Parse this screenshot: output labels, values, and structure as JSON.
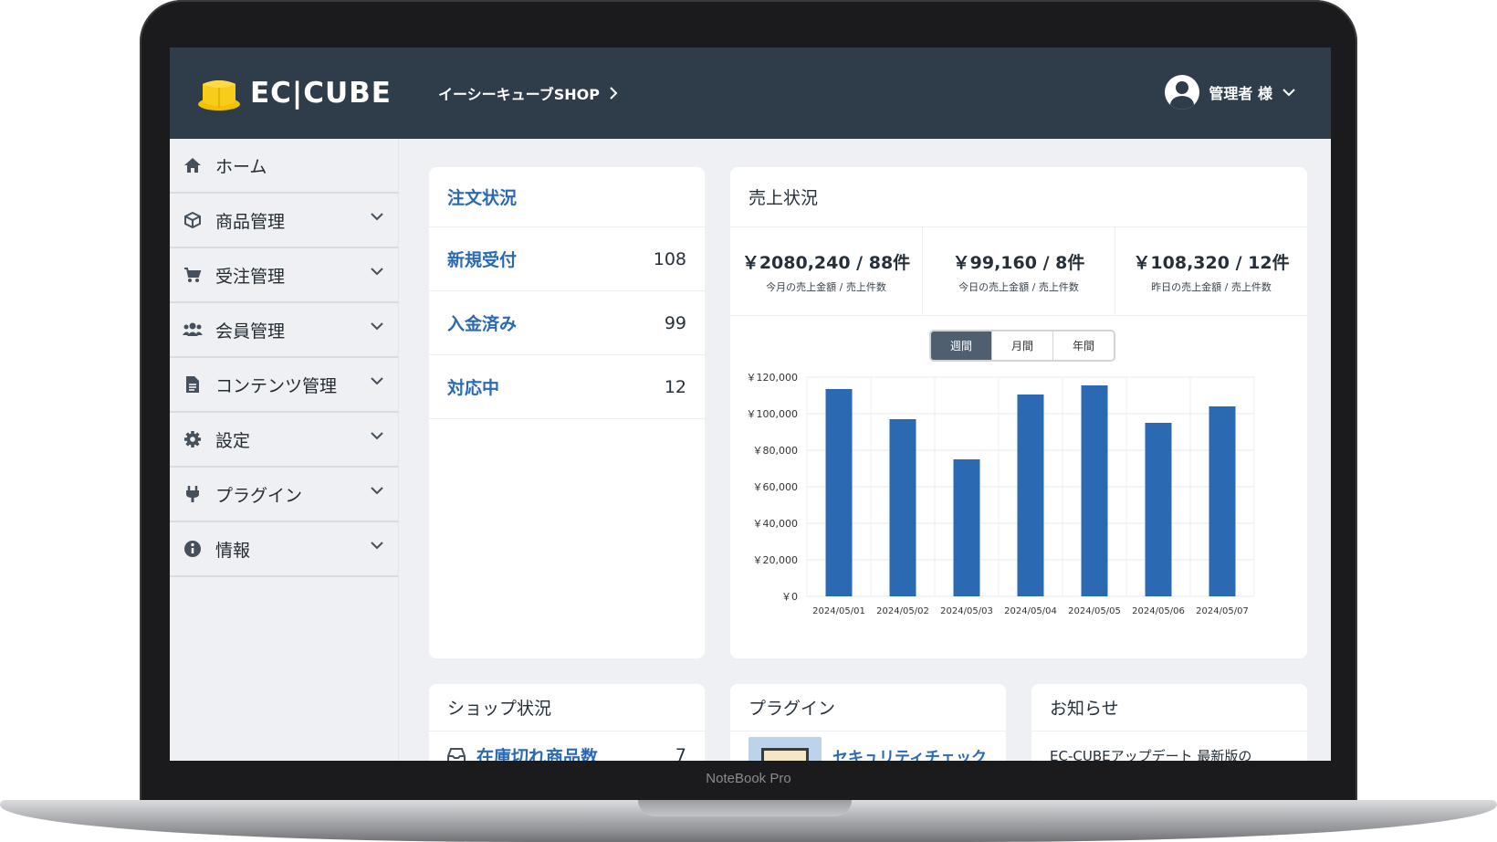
{
  "device": {
    "label": "NoteBook Pro"
  },
  "header": {
    "logo_text": "EC|CUBE",
    "shop_name": "イーシーキューブSHOP",
    "user_name": "管理者 様"
  },
  "sidebar": {
    "items": [
      {
        "label": "ホーム",
        "icon": "home-icon"
      },
      {
        "label": "商品管理",
        "icon": "box-icon"
      },
      {
        "label": "受注管理",
        "icon": "cart-icon"
      },
      {
        "label": "会員管理",
        "icon": "users-icon"
      },
      {
        "label": "コンテンツ管理",
        "icon": "file-icon"
      },
      {
        "label": "設定",
        "icon": "gear-icon"
      },
      {
        "label": "プラグイン",
        "icon": "plug-icon"
      },
      {
        "label": "情報",
        "icon": "info-icon"
      }
    ]
  },
  "orders": {
    "title": "注文状況",
    "rows": [
      {
        "label": "新規受付",
        "value": "108"
      },
      {
        "label": "入金済み",
        "value": "99"
      },
      {
        "label": "対応中",
        "value": "12"
      }
    ]
  },
  "sales": {
    "title": "売上状況",
    "stats": [
      {
        "value": "￥2080,240 / 88件",
        "caption": "今月の売上金額 / 売上件数"
      },
      {
        "value": "￥99,160 / 8件",
        "caption": "今日の売上金額 / 売上件数"
      },
      {
        "value": "￥108,320 / 12件",
        "caption": "昨日の売上金額 / 売上件数"
      }
    ],
    "periods": [
      "週間",
      "月間",
      "年間"
    ],
    "active_period": "週間"
  },
  "chart_data": {
    "type": "bar",
    "categories": [
      "2024/05/01",
      "2024/05/02",
      "2024/05/03",
      "2024/05/04",
      "2024/05/05",
      "2024/05/06",
      "2024/05/07"
    ],
    "values": [
      113500,
      97000,
      75000,
      110500,
      115500,
      95000,
      104000
    ],
    "y_ticks": [
      "￥0",
      "￥20,000",
      "￥40,000",
      "￥60,000",
      "￥80,000",
      "￥100,000",
      "￥120,000"
    ],
    "ylim": [
      0,
      120000
    ],
    "grid": true,
    "bar_color": "#2b6ab3"
  },
  "shop_status": {
    "title": "ショップ状況",
    "first_row_label": "在庫切れ商品数",
    "first_row_value": "7"
  },
  "plugins": {
    "title": "プラグイン",
    "first_item": "セキュリティチェック"
  },
  "news": {
    "title": "お知らせ",
    "first_item": "EC-CUBEアップデート 最新版の"
  },
  "colors": {
    "header_bg": "#2f3c4a",
    "accent": "#2b6ab3",
    "logo_yellow": "#f2c100"
  }
}
